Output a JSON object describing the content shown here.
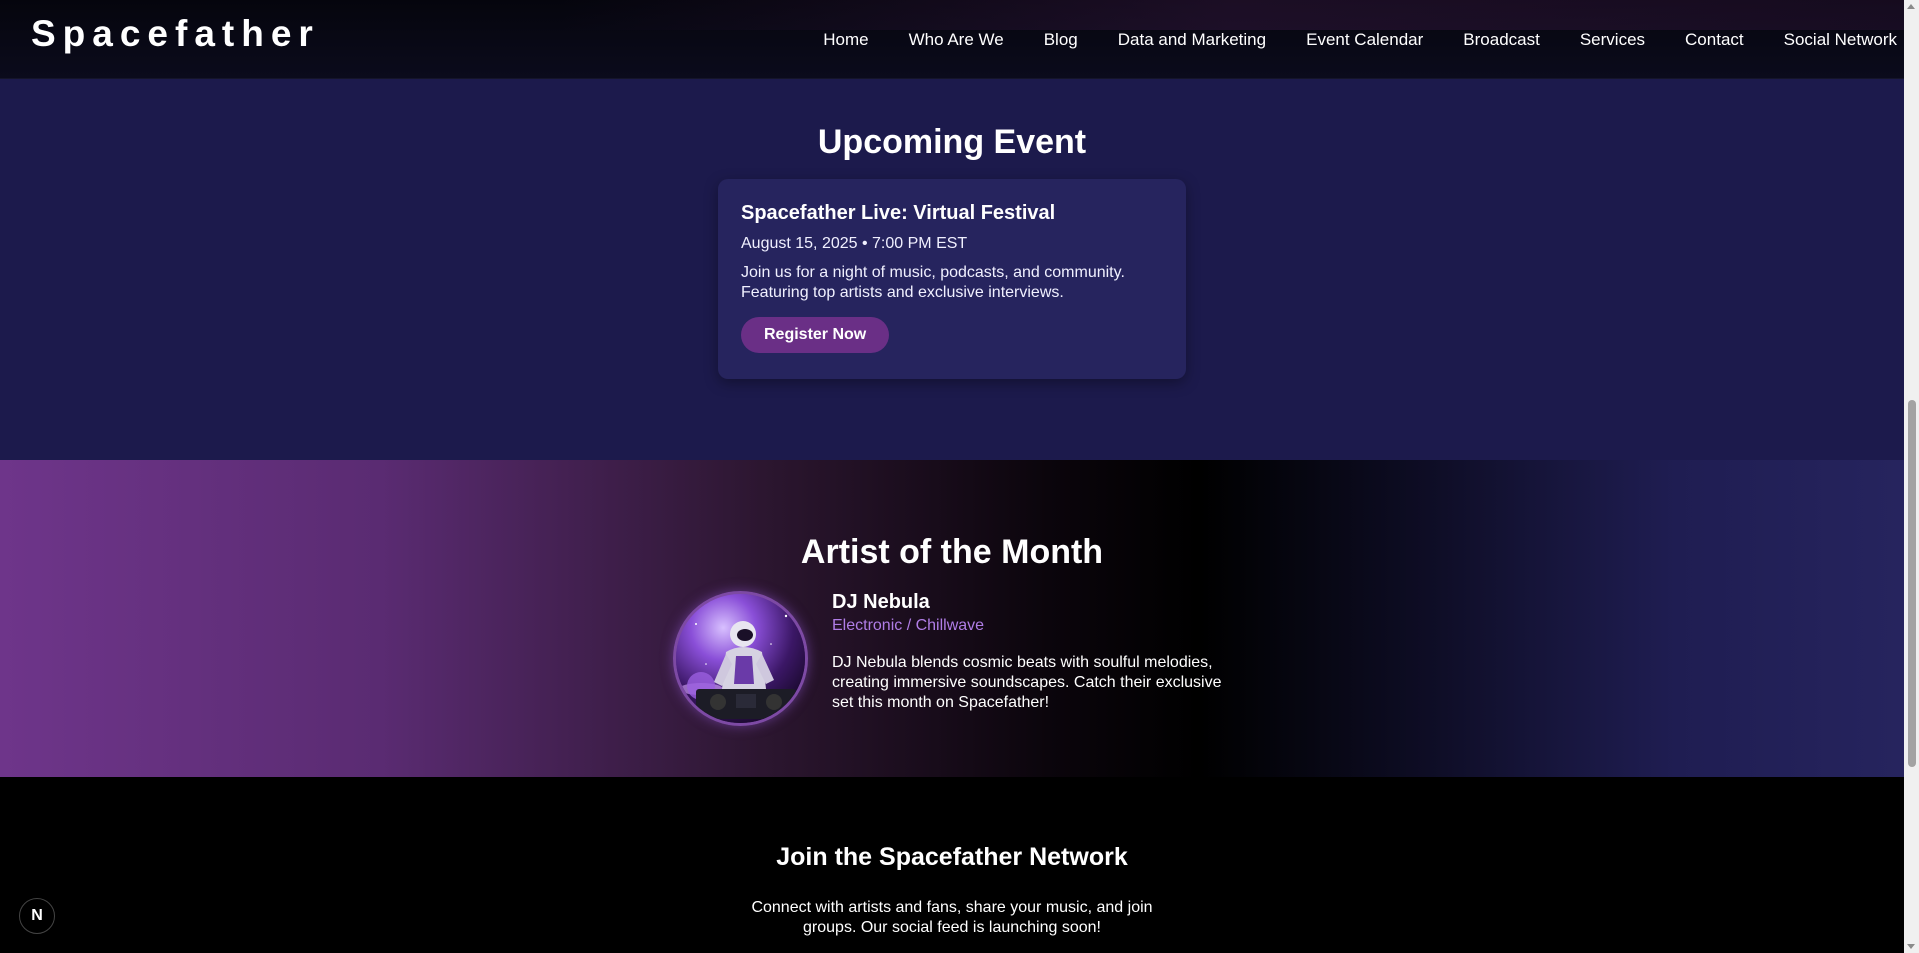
{
  "header": {
    "brand": "Spacefather",
    "nav": [
      "Home",
      "Who Are We",
      "Blog",
      "Data and Marketing",
      "Event Calendar",
      "Broadcast",
      "Services",
      "Contact",
      "Social Network"
    ]
  },
  "upcoming": {
    "title": "Upcoming Event",
    "event_title": "Spacefather Live: Virtual Festival",
    "date": "August 15, 2025 • 7:00 PM EST",
    "description": "Join us for a night of music, podcasts, and community. Featuring top artists and exclusive interviews.",
    "button_label": "Register Now"
  },
  "artist": {
    "title": "Artist of the Month",
    "name": "DJ Nebula",
    "genre": "Electronic / Chillwave",
    "bio": "DJ Nebula blends cosmic beats with soulful melodies, creating immersive soundscapes. Catch their exclusive set this month on Spacefather!",
    "image_icon": "astronaut-dj-illustration"
  },
  "join": {
    "title": "Join the Spacefather Network",
    "text": "Connect with artists and fans, share your music, and join groups. Our social feed is launching soon!"
  },
  "badge": {
    "label": "N"
  },
  "colors": {
    "accent_purple": "#6a2f86",
    "genre_text": "#b07de6",
    "event_card": "#26245e",
    "section_bg": "#1c1a4c"
  }
}
